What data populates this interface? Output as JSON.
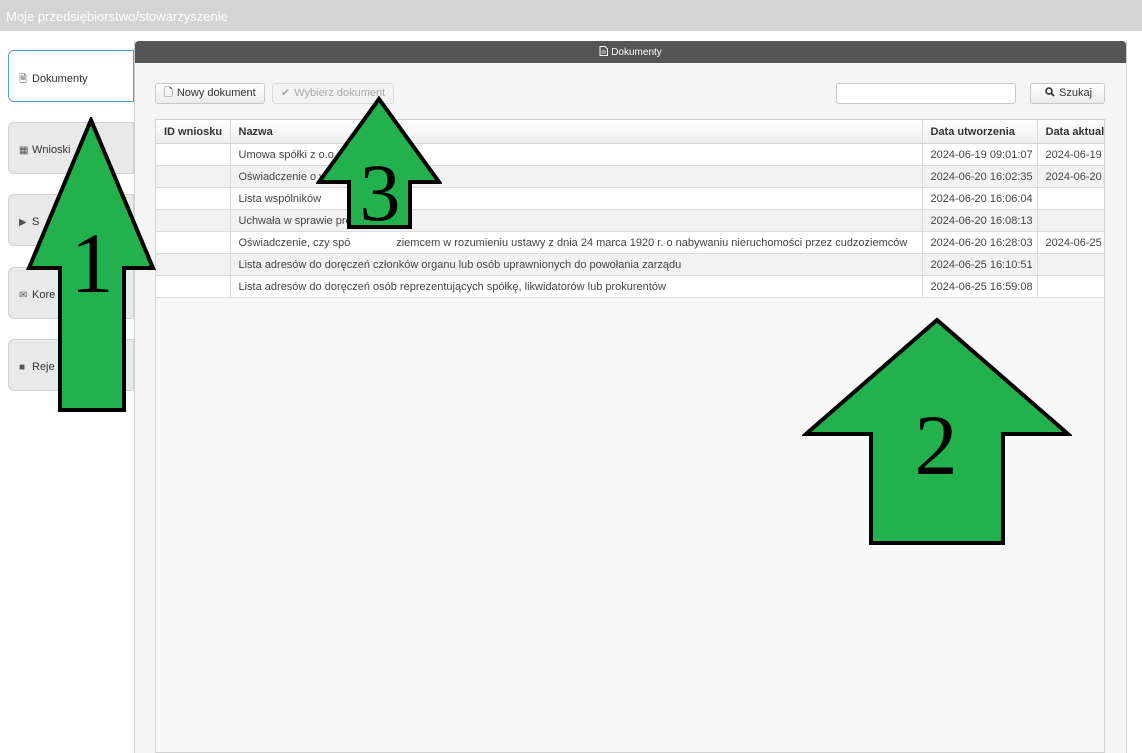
{
  "app": {
    "title": "Moje przedsiębiorstwo/stowarzyszenie"
  },
  "sidebar": {
    "items": [
      {
        "label": "Dokumenty",
        "icon": "document-icon"
      },
      {
        "label": "Wnioski",
        "icon": "form-icon"
      },
      {
        "label": "S",
        "icon": "folder-open-icon"
      },
      {
        "label": "Kore",
        "icon": "envelope-icon"
      },
      {
        "label": "Reje",
        "icon": "briefcase-icon"
      }
    ]
  },
  "panel": {
    "title": "Dokumenty"
  },
  "toolbar": {
    "new_document": "Nowy dokument",
    "select_document": "Wybierz dokument",
    "search_placeholder": "",
    "search_button": "Szukaj"
  },
  "table": {
    "columns": [
      "ID wniosku",
      "Nazwa",
      "Data utworzenia",
      "Data aktuali"
    ],
    "rows": [
      {
        "id": "",
        "name": "Umowa spółki z o.o.",
        "created": "2024-06-19 09:01:07",
        "updated": "2024-06-19"
      },
      {
        "id": "",
        "name": "Oświadczenie o w",
        "created": "2024-06-20 16:02:35",
        "updated": "2024-06-20"
      },
      {
        "id": "",
        "name": "Lista wspólników",
        "created": "2024-06-20 16:06:04",
        "updated": ""
      },
      {
        "id": "",
        "name": "Uchwała w sprawie pro",
        "created": "2024-06-20 16:08:13",
        "updated": ""
      },
      {
        "id": "",
        "name": "Oświadczenie, czy spó               ziemcem w rozumieniu ustawy z dnia 24 marca 1920 r. o nabywaniu nieruchomości przez cudzoziemców",
        "created": "2024-06-20 16:28:03",
        "updated": "2024-06-25"
      },
      {
        "id": "",
        "name": "Lista adresów do doręczeń członków organu lub osób uprawnionych do powołania zarządu",
        "created": "2024-06-25 16:10:51",
        "updated": ""
      },
      {
        "id": "",
        "name": "Lista adresów do doręczeń osób reprezentujących spółkę, likwidatorów lub prokurentów",
        "created": "2024-06-25 16:59:08",
        "updated": ""
      }
    ]
  },
  "annotations": {
    "arrow1": "1",
    "arrow2": "2",
    "arrow3": "3",
    "color": "#22b14c"
  }
}
